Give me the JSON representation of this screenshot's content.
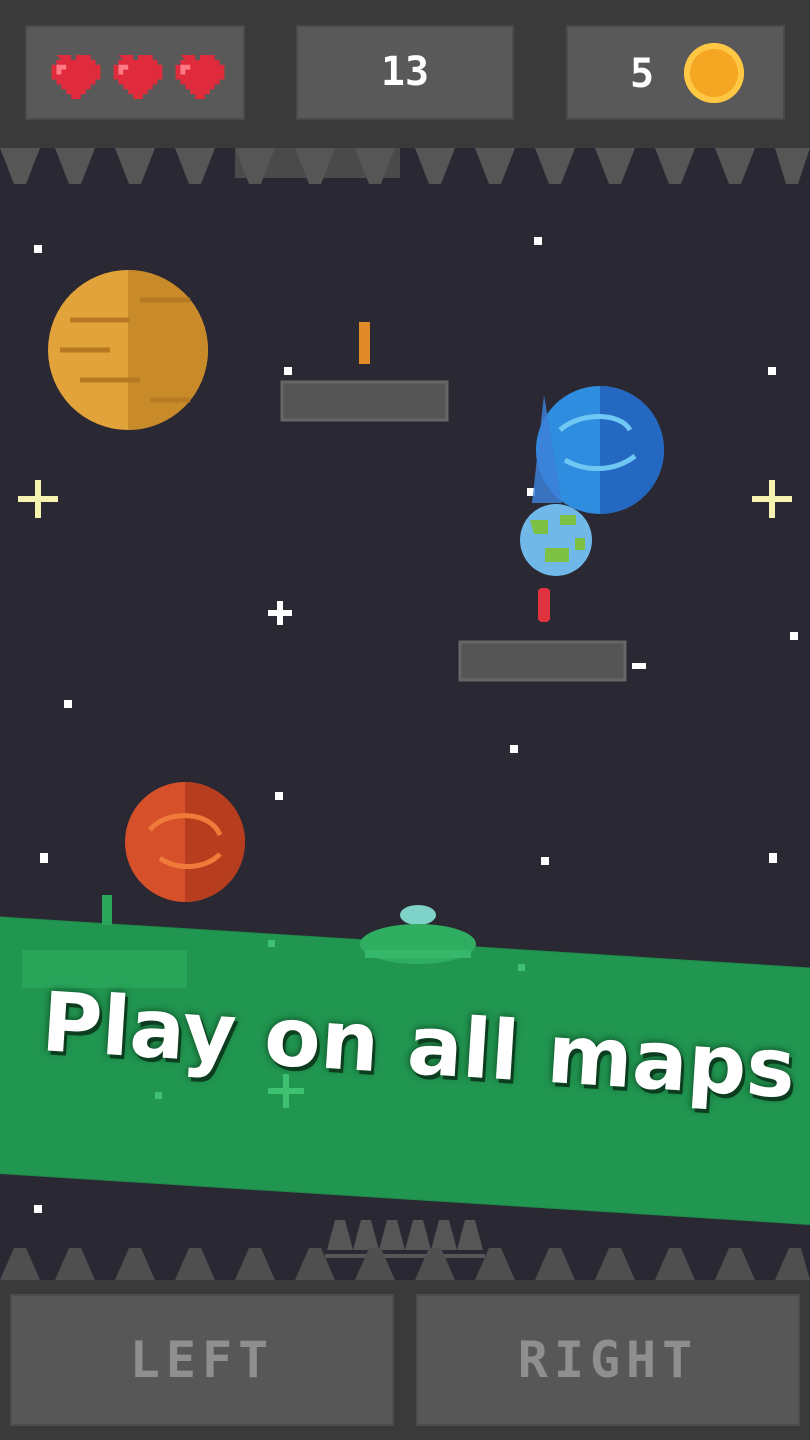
{
  "hud": {
    "lives": 3,
    "score": "13",
    "coin_count": "5"
  },
  "promo": {
    "text": "Play on all maps"
  },
  "controls": {
    "left_label": "LEFT",
    "right_label": "RIGHT"
  },
  "colors": {
    "background": "#2a2833",
    "hud_bar": "#3a3a3a",
    "panel": "#595959",
    "banner": "#219650",
    "heart": "#e02b3c",
    "coin": "#f5a623",
    "platform": "#555555"
  },
  "icons": [
    "heart-icon",
    "coin-icon",
    "spike-icon",
    "star-icon",
    "planet-icon",
    "ufo-icon",
    "ball-icon"
  ]
}
